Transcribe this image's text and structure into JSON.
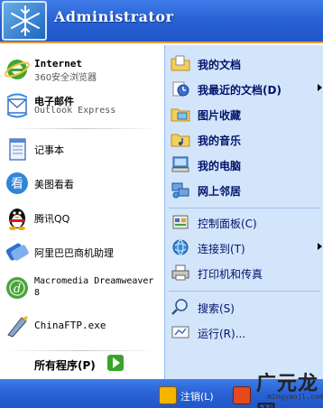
{
  "header": {
    "username": "Administrator"
  },
  "pinned": [
    {
      "title": "Internet",
      "subtitle": "360安全浏览器",
      "icon": "internet-explorer-icon"
    },
    {
      "title": "电子邮件",
      "subtitle": "Outlook Express",
      "icon": "outlook-icon"
    }
  ],
  "recent": [
    {
      "label": "记事本",
      "icon": "notepad-icon"
    },
    {
      "label": "美图看看",
      "icon": "meitu-viewer-icon"
    },
    {
      "label": "腾讯QQ",
      "icon": "qq-penguin-icon"
    },
    {
      "label": "阿里巴巴商机助理",
      "icon": "alibaba-icon"
    },
    {
      "label": "Macromedia Dreamweaver",
      "label2": "8",
      "icon": "dreamweaver-icon"
    },
    {
      "label": "ChinaFTP.exe",
      "icon": "chinaftp-icon"
    }
  ],
  "all_programs": {
    "label": "所有程序(P)",
    "icon": "green-arrow-icon"
  },
  "places": [
    {
      "label": "我的文档",
      "icon": "my-documents-icon",
      "bold": true,
      "arrow": false
    },
    {
      "label": "我最近的文档(D)",
      "icon": "recent-documents-icon",
      "bold": true,
      "arrow": true
    },
    {
      "label": "图片收藏",
      "icon": "my-pictures-icon",
      "bold": true,
      "arrow": false
    },
    {
      "label": "我的音乐",
      "icon": "my-music-icon",
      "bold": true,
      "arrow": false
    },
    {
      "label": "我的电脑",
      "icon": "my-computer-icon",
      "bold": true,
      "arrow": false
    },
    {
      "label": "网上邻居",
      "icon": "network-places-icon",
      "bold": true,
      "arrow": false
    }
  ],
  "system": [
    {
      "label": "控制面板(C)",
      "icon": "control-panel-icon",
      "arrow": false
    },
    {
      "label": "连接到(T)",
      "icon": "connect-to-icon",
      "arrow": true
    },
    {
      "label": "打印机和传真",
      "icon": "printers-icon",
      "arrow": false
    }
  ],
  "tools": [
    {
      "label": "搜索(S)",
      "icon": "search-icon"
    },
    {
      "label": "运行(R)...",
      "icon": "run-icon"
    }
  ],
  "footer": {
    "logoff_label": "注销(L)"
  },
  "watermark": {
    "text": "广元龙网",
    "url": "mingyanjl.com"
  },
  "colors": {
    "header_blue": "#2a63d6",
    "right_pane": "#d3e5fa",
    "accent_orange": "#e79b3c"
  }
}
